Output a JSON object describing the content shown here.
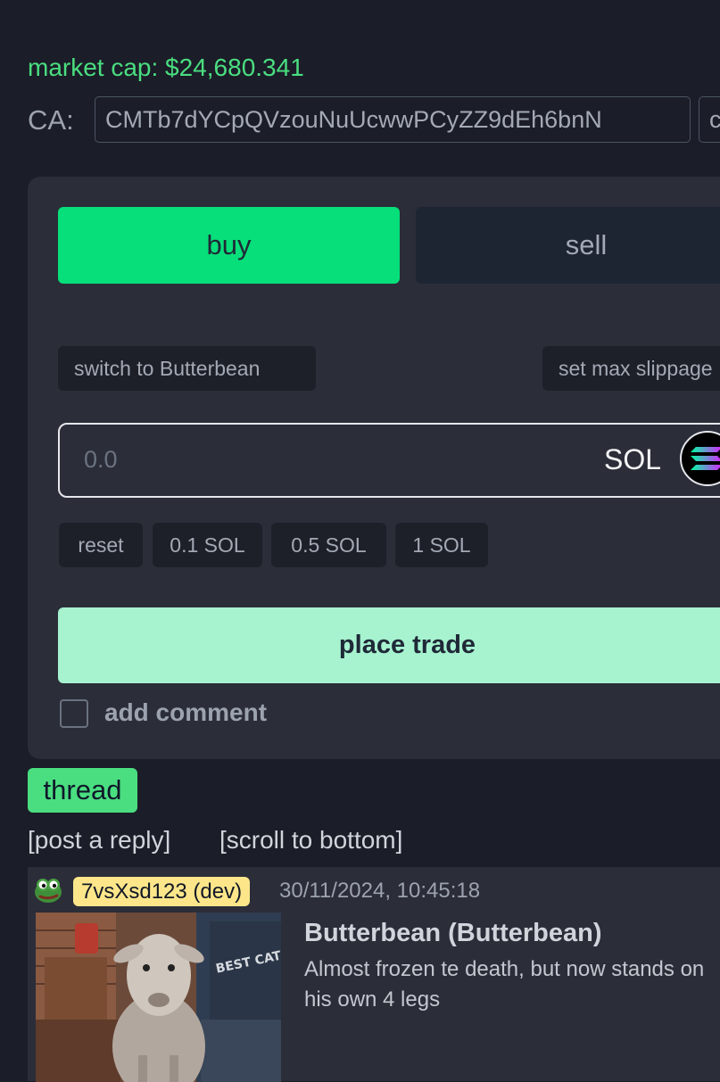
{
  "market": {
    "label": "market cap: $24,680.341"
  },
  "contract": {
    "label": "CA:",
    "address": "CMTb7dYCpQVzouNuUcwwPCyZZ9dEh6bnN",
    "copy_label": "c"
  },
  "trade": {
    "buy_label": "buy",
    "sell_label": "sell",
    "switch_label": "switch to Butterbean",
    "slippage_label": "set max slippage",
    "amount_placeholder": "0.0",
    "currency": "SOL",
    "quick_amounts": [
      "reset",
      "0.1 SOL",
      "0.5 SOL",
      "1 SOL"
    ],
    "place_trade_label": "place trade",
    "add_comment_label": "add comment",
    "add_comment_checked": false
  },
  "thread": {
    "tab_label": "thread",
    "post_reply_label": "[post a reply]",
    "scroll_bottom_label": "[scroll to bottom]",
    "replies": [
      {
        "user": "7vsXsd123 (dev)",
        "timestamp": "30/11/2024, 10:45:18",
        "token_title": "Butterbean (Butterbean)",
        "description": "Almost frozen te death, but now stands on his own 4 legs",
        "shirt_text": "BEST CAT DAD EVER"
      }
    ]
  },
  "colors": {
    "background": "#1b1d28",
    "panel": "#2b2d39",
    "buy": "#07df7a",
    "sell": "#1d2533",
    "place_trade": "#a7f3d0",
    "market_cap": "#4ade80",
    "thread_tag": "#4ade80",
    "user_badge": "#fde68a"
  }
}
